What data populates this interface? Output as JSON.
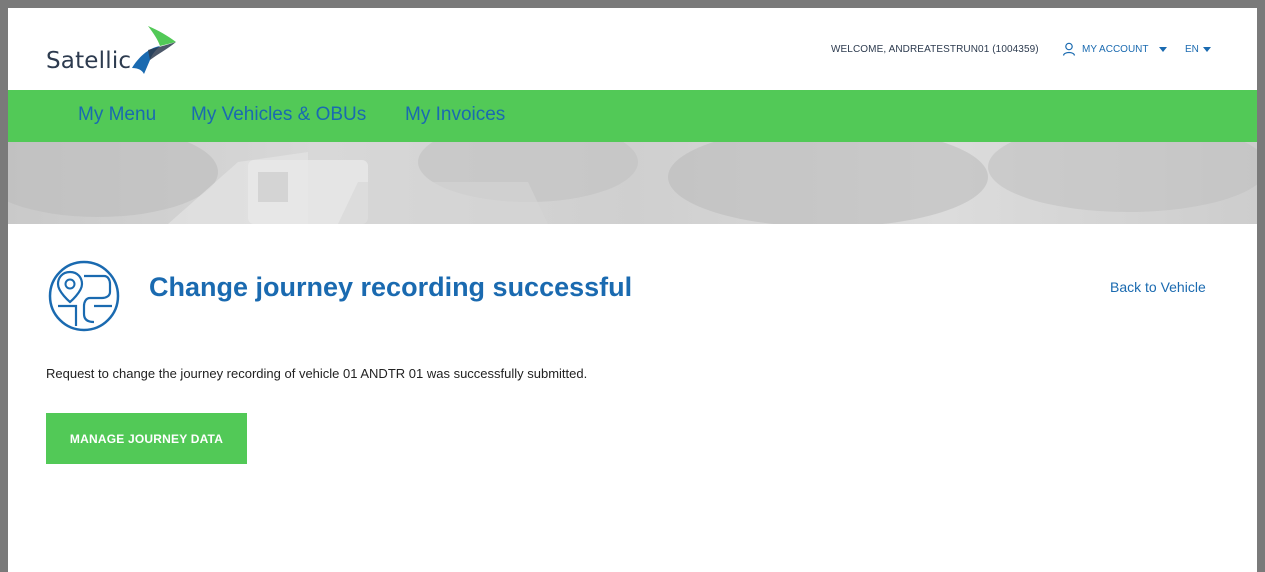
{
  "header": {
    "logo_text": "Satellic",
    "welcome_text": "WELCOME, ANDREATESTRUN01 (1004359)",
    "account_label": "MY ACCOUNT",
    "language_label": "EN"
  },
  "nav": {
    "items": [
      {
        "label": "My Menu"
      },
      {
        "label": "My Vehicles & OBUs"
      },
      {
        "label": "My Invoices"
      }
    ]
  },
  "content": {
    "title": "Change journey recording successful",
    "back_link": "Back to Vehicle",
    "message": "Request to change the journey recording of vehicle 01 ANDTR 01 was successfully submitted.",
    "primary_button": "MANAGE JOURNEY DATA"
  },
  "colors": {
    "brand_green": "#52c957",
    "brand_blue": "#1a6ab0",
    "text_dark": "#2d3b4f"
  },
  "icons": {
    "logo": "satellic-swoosh-logo",
    "account": "user-icon",
    "heading": "map-pin-icon"
  }
}
